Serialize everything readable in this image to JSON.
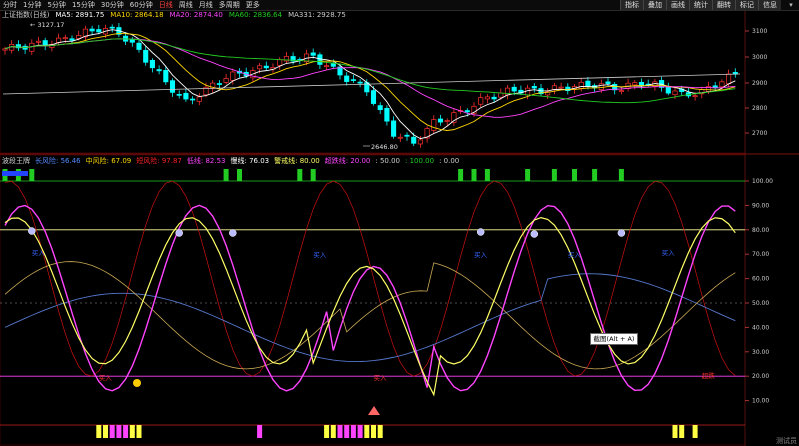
{
  "toolbar": {
    "timeframes": [
      "分时",
      "1分钟",
      "5分钟",
      "15分钟",
      "30分钟",
      "60分钟",
      "日线",
      "周线",
      "月线",
      "多周期",
      "更多"
    ],
    "active_index": 6,
    "right_buttons": [
      "指标",
      "叠加",
      "画线",
      "统计",
      "翻转",
      "标记",
      "信息"
    ]
  },
  "main_legend": {
    "title": "上证指数(日线)",
    "items": [
      {
        "label": "MA5: 2891.75",
        "color": "#ffffff"
      },
      {
        "label": "MA10: 2864.18",
        "color": "#ffd700"
      },
      {
        "label": "MA20: 2874.40",
        "color": "#ff44ff"
      },
      {
        "label": "MA60: 2836.64",
        "color": "#22cc22"
      },
      {
        "label": "MA331: 2928.75",
        "color": "#cccccc"
      }
    ]
  },
  "main_annotations": {
    "high": "3127.17",
    "low": "2646.80"
  },
  "main_axis": [
    "3100",
    "3000",
    "2900",
    "2800",
    "2700"
  ],
  "ind_legend": {
    "title": "波段王牌",
    "items": [
      {
        "label": "长风险: 56.46",
        "color": "#5588ff"
      },
      {
        "label": "中风险: 67.09",
        "color": "#ffd700"
      },
      {
        "label": "短风险: 97.87",
        "color": "#ff2222"
      },
      {
        "label": "低线: 82.53",
        "color": "#ff44ff"
      },
      {
        "label": "慢线: 76.03",
        "color": "#ffffff"
      },
      {
        "label": "警戒线: 80.00",
        "color": "#ffff66"
      },
      {
        "label": "超跌线: 20.00",
        "color": "#ff44ff"
      },
      {
        "label": ": 50.00",
        "color": "#cccccc"
      },
      {
        "label": ": 100.00",
        "color": "#22cc22"
      },
      {
        "label": ": 0.00",
        "color": "#cccccc"
      }
    ]
  },
  "ind_axis": [
    "100.00",
    "90.00",
    "80.00",
    "70.00",
    "60.00",
    "50.00",
    "40.00",
    "30.00",
    "20.00",
    "10.00"
  ],
  "annotations": {
    "buy_labels": [
      "买入",
      "买入",
      "买入",
      "买入",
      "买入",
      "买入",
      "买入"
    ],
    "oversold_label": "超跌",
    "screenshot_tooltip": "截图(Alt + A)",
    "watermark": "测试员"
  },
  "colors": {
    "up": "#ff3030",
    "down": "#00ffff",
    "ma5": "#ffffff",
    "ma10": "#ffd700",
    "ma20": "#ff44ff",
    "ma60": "#22cc22"
  }
}
